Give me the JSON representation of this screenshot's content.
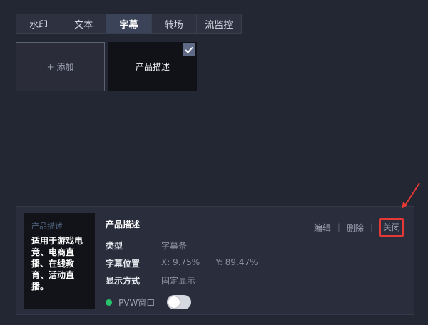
{
  "tabs": [
    {
      "label": "水印"
    },
    {
      "label": "文本"
    },
    {
      "label": "字幕",
      "active": true
    },
    {
      "label": "转场"
    },
    {
      "label": "流监控"
    }
  ],
  "add_tile": {
    "label": "+ 添加"
  },
  "subtitle_tile": {
    "label": "产品描述",
    "selected": true,
    "check_icon": "check-icon"
  },
  "detail": {
    "preview_title": "产品描述",
    "preview_text": "适用于游戏电竞、电商直播、在线教育、活动直播。",
    "title": "产品描述",
    "actions": {
      "edit": "编辑",
      "delete": "删除",
      "close": "关闭",
      "sep": "|"
    },
    "type_label": "类型",
    "type_value": "字幕条",
    "position_label": "字幕位置",
    "position_x": "X: 9.75%",
    "position_y": "Y: 89.47%",
    "display_label": "显示方式",
    "display_value": "固定显示",
    "pvw_label": "PVW窗口",
    "pvw_enabled": false
  },
  "colors": {
    "accent_red": "#e53935",
    "status_green": "#27c26a",
    "background": "#232633"
  }
}
